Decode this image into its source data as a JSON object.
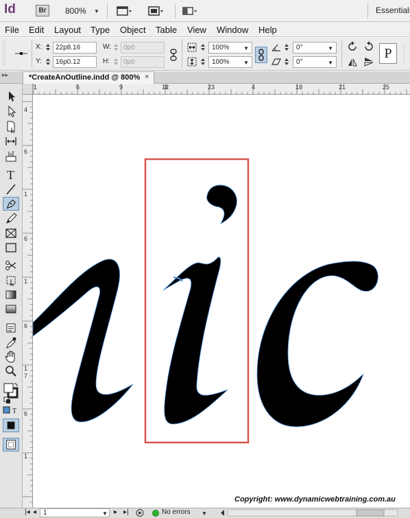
{
  "app": {
    "logo": "Id",
    "bridge": "Br",
    "zoom": "800%",
    "workspace": "Essentials"
  },
  "menu": [
    "File",
    "Edit",
    "Layout",
    "Type",
    "Object",
    "Table",
    "View",
    "Window",
    "Help"
  ],
  "control": {
    "x_label": "X:",
    "x_value": "22p8.16",
    "y_label": "Y:",
    "y_value": "16p0.12",
    "w_label": "W:",
    "w_value": "0p0",
    "h_label": "H:",
    "h_value": "0p0",
    "scale_x": "100%",
    "scale_y": "100%",
    "rotate": "0°",
    "shear": "0°",
    "p_label": "P"
  },
  "document": {
    "tab_title": "*CreateAnOutline.indd @ 800%",
    "close": "×"
  },
  "rulers": {
    "horizontal": [
      "1",
      "6",
      "9",
      "12",
      "6",
      "23",
      "4",
      "18",
      "21",
      "25"
    ],
    "vertical": [
      "4",
      "6",
      "1",
      "6",
      "1",
      "6",
      "1",
      "7",
      "6",
      "1"
    ]
  },
  "artwork": {
    "letters": "ic",
    "selection_color": "#d9534f",
    "fill_color": "#000000",
    "path_color": "#4a90d9"
  },
  "copyright": "Copyright: www.dynamicwebtraining.com.au",
  "status": {
    "page": "1",
    "errors": "No errors"
  }
}
